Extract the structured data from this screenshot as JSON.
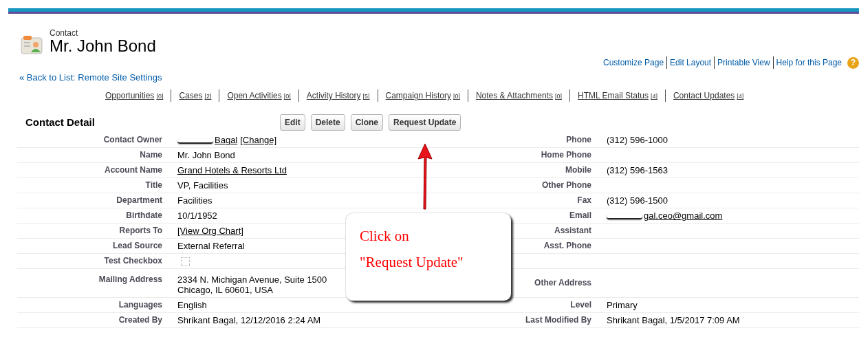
{
  "header": {
    "object_type": "Contact",
    "title": "Mr. John Bond"
  },
  "top_links": [
    "Customize Page",
    "Edit Layout",
    "Printable View",
    "Help for this Page"
  ],
  "help_icon": "?",
  "back_link": "« Back to List: Remote Site Settings",
  "related_lists": [
    {
      "label": "Opportunities",
      "count": "[0]"
    },
    {
      "label": "Cases",
      "count": "[2]"
    },
    {
      "label": "Open Activities",
      "count": "[0]"
    },
    {
      "label": "Activity History",
      "count": "[5]"
    },
    {
      "label": "Campaign History",
      "count": "[0]"
    },
    {
      "label": "Notes & Attachments",
      "count": "[0]"
    },
    {
      "label": "HTML Email Status",
      "count": "[4]"
    },
    {
      "label": "Contact Updates",
      "count": "[4]"
    }
  ],
  "detail": {
    "title": "Contact Detail",
    "buttons": [
      "Edit",
      "Delete",
      "Clone",
      "Request Update"
    ],
    "rows": [
      {
        "left": {
          "label": "Contact Owner",
          "kind": "links",
          "redacted": true,
          "parts": [
            "Bagal",
            "[Change]"
          ]
        },
        "right": {
          "label": "Phone",
          "kind": "text",
          "value": "(312) 596-1000"
        }
      },
      {
        "left": {
          "label": "Name",
          "kind": "text",
          "value": "Mr. John Bond"
        },
        "right": {
          "label": "Home Phone",
          "kind": "empty"
        }
      },
      {
        "left": {
          "label": "Account Name",
          "kind": "links",
          "parts": [
            "Grand Hotels & Resorts Ltd"
          ]
        },
        "right": {
          "label": "Mobile",
          "kind": "text",
          "value": "(312) 596-1563"
        }
      },
      {
        "left": {
          "label": "Title",
          "kind": "text",
          "value": "VP, Facilities"
        },
        "right": {
          "label": "Other Phone",
          "kind": "empty"
        }
      },
      {
        "left": {
          "label": "Department",
          "kind": "text",
          "value": "Facilities"
        },
        "right": {
          "label": "Fax",
          "kind": "text",
          "value": "(312) 596-1500"
        }
      },
      {
        "left": {
          "label": "Birthdate",
          "kind": "text",
          "value": "10/1/1952"
        },
        "right": {
          "label": "Email",
          "kind": "links",
          "redacted": true,
          "parts": [
            "gal.ceo@gmail.com"
          ]
        }
      },
      {
        "left": {
          "label": "Reports To",
          "kind": "links",
          "parts": [
            "[View Org Chart]"
          ]
        },
        "right": {
          "label": "Assistant",
          "kind": "empty"
        }
      },
      {
        "left": {
          "label": "Lead Source",
          "kind": "text",
          "value": "External Referral"
        },
        "right": {
          "label": "Asst. Phone",
          "kind": "empty"
        }
      },
      {
        "left": {
          "label": "Test Checkbox",
          "kind": "checkbox",
          "checked": false
        },
        "right": {
          "kind": "empty"
        }
      },
      {
        "left": {
          "label": "Mailing Address",
          "kind": "multiline",
          "lines": [
            "2334 N. Michigan Avenue, Suite 1500",
            "Chicago, IL 60601, USA"
          ]
        },
        "right": {
          "label": "Other Address",
          "kind": "empty"
        }
      },
      {
        "left": {
          "label": "Languages",
          "kind": "text",
          "value": "English"
        },
        "right": {
          "label": "Level",
          "kind": "text",
          "value": "Primary"
        }
      },
      {
        "left": {
          "label": "Created By",
          "kind": "text",
          "value": "Shrikant Bagal, 12/12/2016 2:24 AM"
        },
        "right": {
          "label": "Last Modified By",
          "kind": "text",
          "value": "Shrikant Bagal, 1/5/2017 7:09 AM"
        }
      }
    ]
  },
  "callout": {
    "lines": [
      "Click on",
      "\"Request Update\""
    ]
  }
}
